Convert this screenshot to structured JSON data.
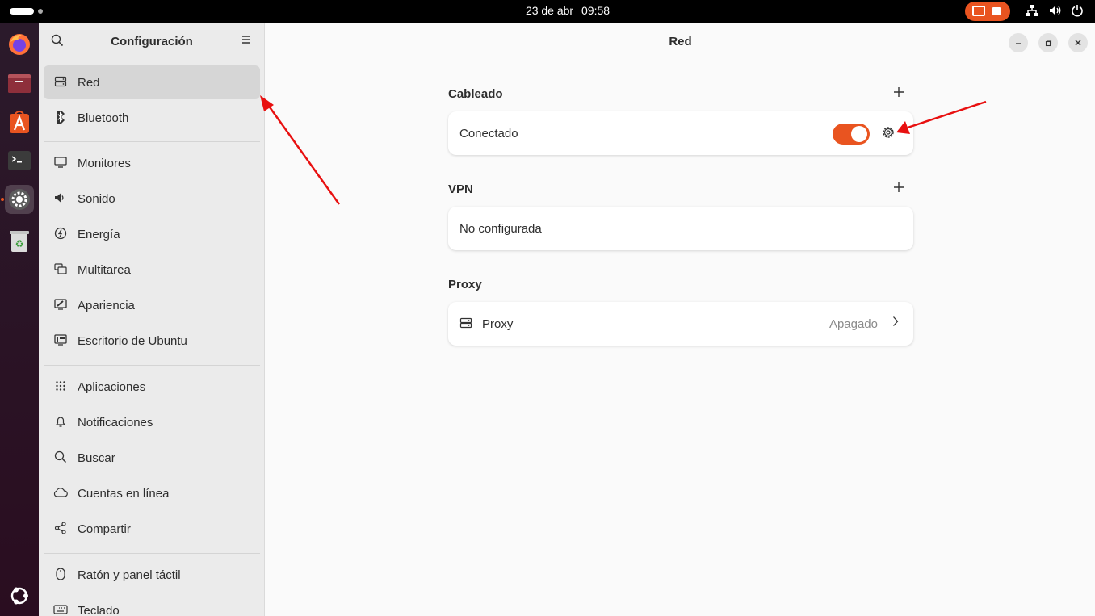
{
  "topbar": {
    "date": "23 de abr",
    "time": "09:58"
  },
  "dock": {
    "items": [
      "firefox-icon",
      "files-icon",
      "app-center-icon",
      "terminal-icon",
      "settings-icon",
      "trash-icon"
    ],
    "bottom": "ubuntu-logo-icon"
  },
  "sidebar": {
    "title": "Configuración",
    "items": [
      {
        "label": "Red",
        "icon": "network-icon"
      },
      {
        "label": "Bluetooth",
        "icon": "bluetooth-icon"
      },
      {
        "label": "Monitores",
        "icon": "monitor-icon"
      },
      {
        "label": "Sonido",
        "icon": "sound-icon"
      },
      {
        "label": "Energía",
        "icon": "power-icon"
      },
      {
        "label": "Multitarea",
        "icon": "multitask-icon"
      },
      {
        "label": "Apariencia",
        "icon": "appearance-icon"
      },
      {
        "label": "Escritorio de Ubuntu",
        "icon": "ubuntu-desktop-icon"
      },
      {
        "label": "Aplicaciones",
        "icon": "apps-grid-icon"
      },
      {
        "label": "Notificaciones",
        "icon": "bell-icon"
      },
      {
        "label": "Buscar",
        "icon": "search-icon"
      },
      {
        "label": "Cuentas en línea",
        "icon": "cloud-icon"
      },
      {
        "label": "Compartir",
        "icon": "share-icon"
      },
      {
        "label": "Ratón y panel táctil",
        "icon": "mouse-icon"
      },
      {
        "label": "Teclado",
        "icon": "keyboard-icon"
      }
    ]
  },
  "main": {
    "title": "Red",
    "wired": {
      "heading": "Cableado",
      "status": "Conectado",
      "enabled": true
    },
    "vpn": {
      "heading": "VPN",
      "status": "No configurada"
    },
    "proxy": {
      "heading": "Proxy",
      "label": "Proxy",
      "value": "Apagado"
    }
  },
  "colors": {
    "accent": "#e95420",
    "annotation_arrow": "#e81010"
  }
}
